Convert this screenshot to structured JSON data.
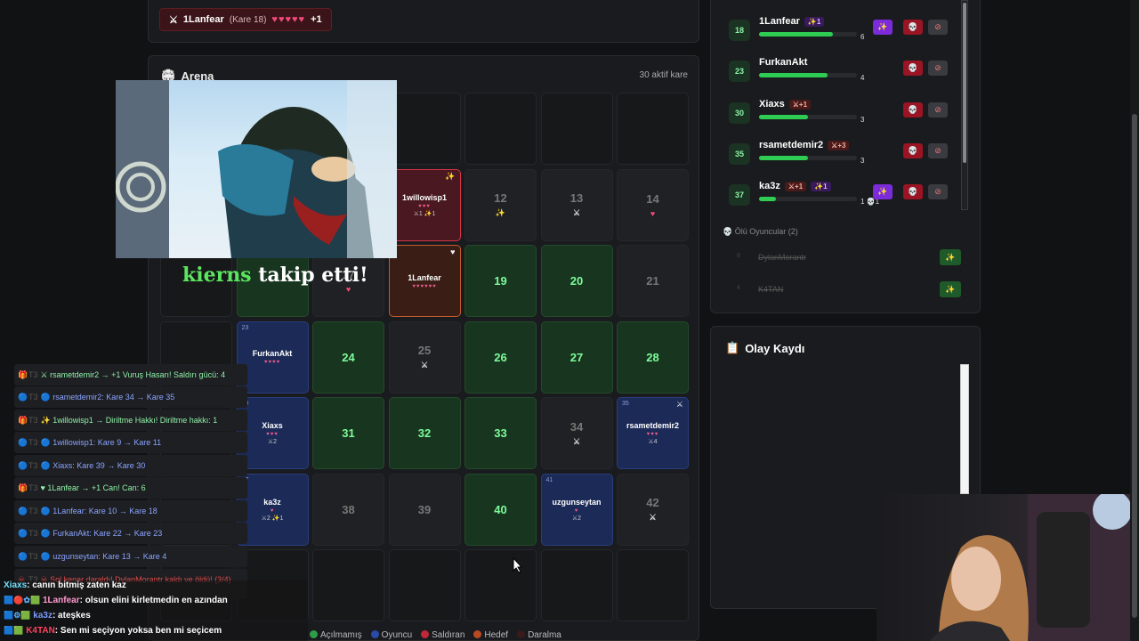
{
  "top_bar": {
    "player_name": "1Lanfear",
    "player_square": "(Kare 18)",
    "hearts": "♥♥♥♥♥",
    "hearts_extra": "+1"
  },
  "arena": {
    "title": "Arena",
    "active_count": "30 aktif kare",
    "cells": [
      {
        "n": "12",
        "kind": "empty",
        "mark": "✨"
      },
      {
        "n": "13",
        "kind": "empty",
        "mark": "⚔"
      },
      {
        "n": "14",
        "kind": "empty",
        "mark": "♥"
      },
      {
        "n": "17",
        "kind": "empty",
        "mark": "♥"
      },
      {
        "n": "19",
        "kind": "open"
      },
      {
        "n": "20",
        "kind": "open"
      },
      {
        "n": "21",
        "kind": "empty"
      },
      {
        "n": "24",
        "kind": "open"
      },
      {
        "n": "25",
        "kind": "empty",
        "mark": "⚔"
      },
      {
        "n": "26",
        "kind": "open"
      },
      {
        "n": "27",
        "kind": "open"
      },
      {
        "n": "28",
        "kind": "open"
      },
      {
        "n": "31",
        "kind": "open"
      },
      {
        "n": "32",
        "kind": "open"
      },
      {
        "n": "33",
        "kind": "open"
      },
      {
        "n": "34",
        "kind": "empty",
        "mark": "⚔"
      },
      {
        "n": "38",
        "kind": "empty"
      },
      {
        "n": "39",
        "kind": "empty"
      },
      {
        "n": "40",
        "kind": "open"
      },
      {
        "n": "42",
        "kind": "empty",
        "mark": "⚔"
      }
    ],
    "player_cells": [
      {
        "num": "",
        "name": "1willowisp1",
        "hearts": "♥♥♥",
        "sub": "⚔1 ✨1",
        "style": "attacker",
        "corner": "✨"
      },
      {
        "num": "",
        "name": "1Lanfear",
        "hearts": "♥♥♥♥♥♥",
        "sub": "",
        "style": "target",
        "corner": "♥"
      },
      {
        "num": "23",
        "name": "FurkanAkt",
        "hearts": "♥♥♥♥",
        "sub": "",
        "style": "player",
        "corner": ""
      },
      {
        "num": "30",
        "name": "Xiaxs",
        "hearts": "♥♥♥",
        "sub": "⚔2",
        "style": "player",
        "corner": ""
      },
      {
        "num": "35",
        "name": "rsametdemir2",
        "hearts": "♥♥♥",
        "sub": "⚔4",
        "style": "player",
        "corner": "⚔"
      },
      {
        "num": "37",
        "name": "ka3z",
        "hearts": "♥",
        "sub": "⚔2 ✨1",
        "style": "player",
        "corner": ""
      },
      {
        "num": "41",
        "name": "uzgunseytan",
        "hearts": "♥",
        "sub": "⚔2",
        "style": "player",
        "corner": ""
      }
    ]
  },
  "overlay": {
    "follower_name": "kierns",
    "follow_text": "takip etti!"
  },
  "legend": {
    "items": [
      {
        "label": "Açılmamış",
        "color": "#2e9e4a"
      },
      {
        "label": "Oyuncu",
        "color": "#2a4aa8"
      },
      {
        "label": "Saldıran",
        "color": "#c0283a"
      },
      {
        "label": "Hedef",
        "color": "#b84a22"
      },
      {
        "label": "Daralma",
        "color": "#3a1a1a"
      }
    ]
  },
  "players": {
    "rows": [
      {
        "rank": "18",
        "name": "1Lanfear",
        "badges": [
          {
            "t": "✨1",
            "k": "s"
          }
        ],
        "fill": 0.75,
        "val": "6",
        "shield": true
      },
      {
        "rank": "23",
        "name": "FurkanAkt",
        "badges": [],
        "fill": 0.7,
        "val": "4",
        "shield": false
      },
      {
        "rank": "30",
        "name": "Xiaxs",
        "badges": [
          {
            "t": "⚔+1",
            "k": "a"
          }
        ],
        "fill": 0.5,
        "val": "3",
        "shield": false
      },
      {
        "rank": "35",
        "name": "rsametdemir2",
        "badges": [
          {
            "t": "⚔+3",
            "k": "a"
          }
        ],
        "fill": 0.5,
        "val": "3",
        "shield": false
      },
      {
        "rank": "37",
        "name": "ka3z",
        "badges": [
          {
            "t": "⚔+1",
            "k": "a"
          },
          {
            "t": "✨1",
            "k": "s"
          }
        ],
        "fill": 0.17,
        "val": "1",
        "extra": "💀1",
        "shield": true
      }
    ],
    "dead_title": "Ölü Oyuncular (2)",
    "dead": [
      {
        "k": "8",
        "name": "DylanMorantr"
      },
      {
        "k": "4",
        "name": "K4TAN"
      }
    ]
  },
  "log": {
    "title": "Olay Kaydı",
    "entries": [
      {
        "type": "buff",
        "icon": "🎁",
        "t": "T3",
        "msg": "⚔ rsametdemir2 → +1 Vuruş Hasarı! Saldırı gücü: 4"
      },
      {
        "type": "move",
        "icon": "🔵",
        "t": "T3",
        "msg": "🔵 rsametdemir2: Kare 34 → Kare 35"
      },
      {
        "type": "buff",
        "icon": "🎁",
        "t": "T3",
        "msg": "✨ 1willowisp1 → Diriltme Hakkı! Diriltme hakkı: 1"
      },
      {
        "type": "move",
        "icon": "🔵",
        "t": "T3",
        "msg": "🔵 1willowisp1: Kare 9 → Kare 11"
      },
      {
        "type": "move",
        "icon": "🔵",
        "t": "T3",
        "msg": "🔵 Xiaxs: Kare 39 → Kare 30"
      },
      {
        "type": "buff",
        "icon": "🎁",
        "t": "T3",
        "msg": "♥ 1Lanfear → +1 Can! Can: 6"
      },
      {
        "type": "move",
        "icon": "🔵",
        "t": "T3",
        "msg": "🔵 1Lanfear: Kare 10 → Kare 18"
      },
      {
        "type": "move",
        "icon": "🔵",
        "t": "T3",
        "msg": "🔵 FurkanAkt: Kare 22 → Kare 23"
      },
      {
        "type": "move",
        "icon": "🔵",
        "t": "T3",
        "msg": "🔵 uzgunseytan: Kare 13 → Kare 4"
      },
      {
        "type": "kill",
        "icon": "☠",
        "t": "T3",
        "msg": "☠ Sol kenar daraldı! DylanMorantr kaldı ve öldü! (3/4)"
      }
    ]
  },
  "chat": [
    {
      "user": "Xiaxs",
      "cls": "u1",
      "badges": "",
      "text": ": canın bitmiş zaten kaz"
    },
    {
      "user": "1Lanfear",
      "cls": "u2",
      "badges": "🟦🔴✿🟩",
      "text": ": olsun elini kirletmedin en azından"
    },
    {
      "user": "ka3z",
      "cls": "u3",
      "badges": "🟦⚙🟩",
      "text": ": ateşkes"
    },
    {
      "user": "K4TAN",
      "cls": "u4",
      "badges": "🟦🟩",
      "text": ": Sen mi seçiyon yoksa ben mi seçicem"
    }
  ]
}
